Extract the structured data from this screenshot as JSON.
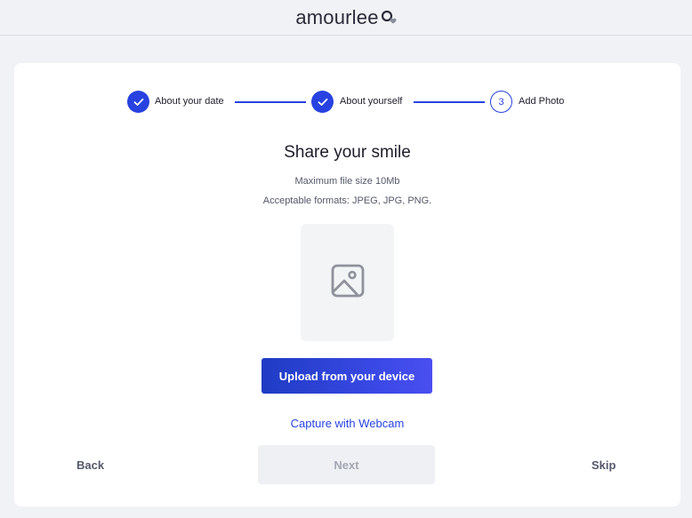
{
  "brand": {
    "name": "amourlee"
  },
  "stepper": {
    "steps": [
      {
        "label": "About your date",
        "status": "done"
      },
      {
        "label": "About yourself",
        "status": "done"
      },
      {
        "label": "Add Photo",
        "status": "current",
        "number": "3"
      }
    ]
  },
  "main": {
    "title": "Share your smile",
    "max_size": "Maximum file size 10Mb",
    "formats": "Acceptable formats: JPEG, JPG, PNG.",
    "upload_label": "Upload from your device",
    "webcam_label": "Capture with Webcam"
  },
  "footer": {
    "back_label": "Back",
    "next_label": "Next",
    "skip_label": "Skip"
  },
  "colors": {
    "accent": "#2742e0",
    "page_bg": "#f1f2f5",
    "disabled_bg": "#eef0f3"
  },
  "icons": {
    "logo": "heart-pin-icon",
    "done": "check-icon",
    "placeholder": "image-icon"
  }
}
